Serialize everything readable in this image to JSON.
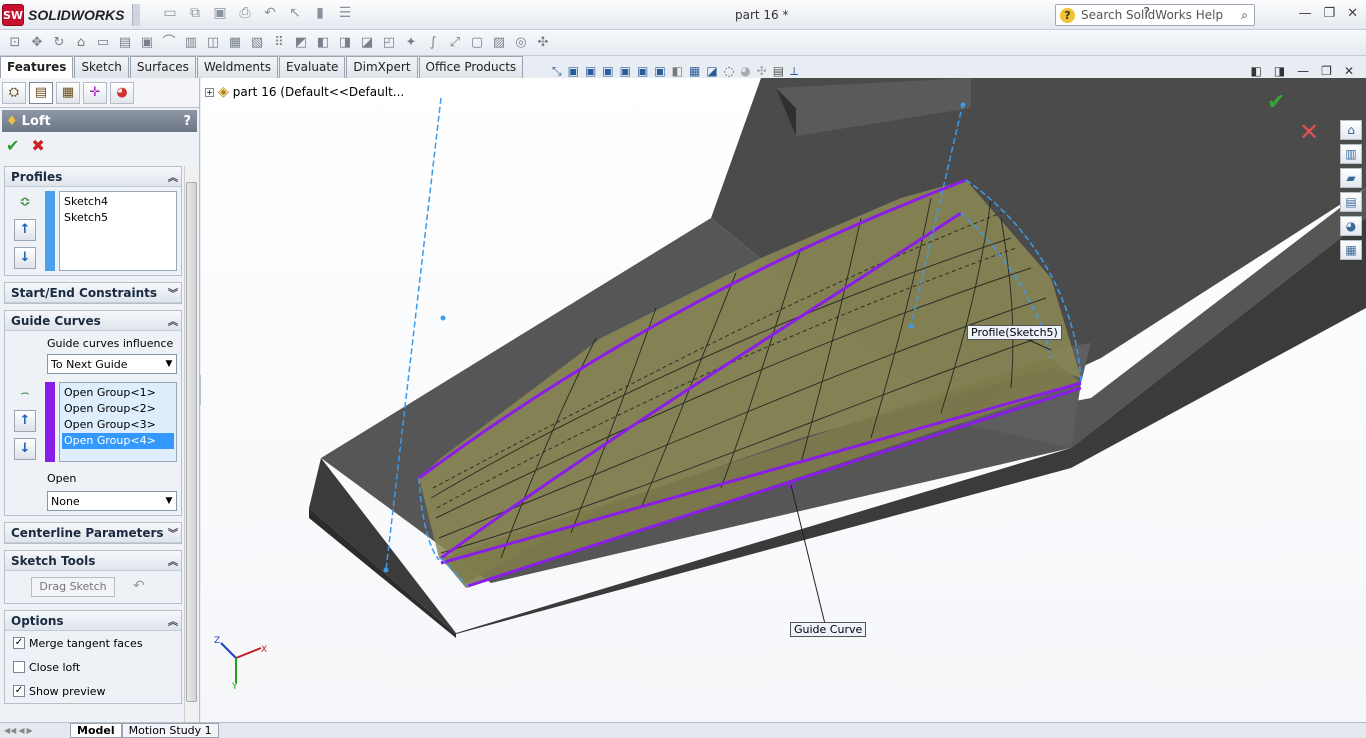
{
  "app": {
    "brand_badge": "SW",
    "brand_name": "SOLIDWORKS",
    "doc_title": "part 16 *"
  },
  "search": {
    "placeholder": "Search SolidWorks Help"
  },
  "command_tabs": [
    "Features",
    "Sketch",
    "Surfaces",
    "Weldments",
    "Evaluate",
    "DimXpert",
    "Office Products"
  ],
  "property_manager": {
    "title": "Loft",
    "help": "?",
    "profiles": {
      "header": "Profiles",
      "items": [
        "Sketch4",
        "Sketch5"
      ]
    },
    "start_end": {
      "header": "Start/End Constraints"
    },
    "guide_curves": {
      "header": "Guide Curves",
      "influence_label": "Guide curves influence",
      "influence_value": "To Next Guide",
      "items": [
        "Open Group<1>",
        "Open Group<2>",
        "Open Group<3>",
        "Open Group<4>"
      ],
      "open_label": "Open",
      "open_value": "None"
    },
    "centerline": {
      "header": "Centerline Parameters"
    },
    "sketch_tools": {
      "header": "Sketch Tools",
      "drag_label": "Drag Sketch"
    },
    "options": {
      "header": "Options",
      "merge_label": "Merge tangent faces",
      "merge_checked": true,
      "close_label": "Close loft",
      "close_checked": false,
      "preview_label": "Show preview",
      "preview_checked": true
    }
  },
  "viewport": {
    "tree_label": "part 16  (Default<<Default...",
    "callout_profile": "Profile(Sketch5)",
    "callout_guide": "Guide Curve",
    "triad": {
      "x": "X",
      "y": "Y",
      "z": "Z"
    }
  },
  "bottom_tabs": [
    "Model",
    "Motion Study 1"
  ],
  "colors": {
    "guide": "#8a1ee8",
    "surface": "#8c8a55",
    "body": "#4a4a4a",
    "dashline": "#3d9be9"
  }
}
